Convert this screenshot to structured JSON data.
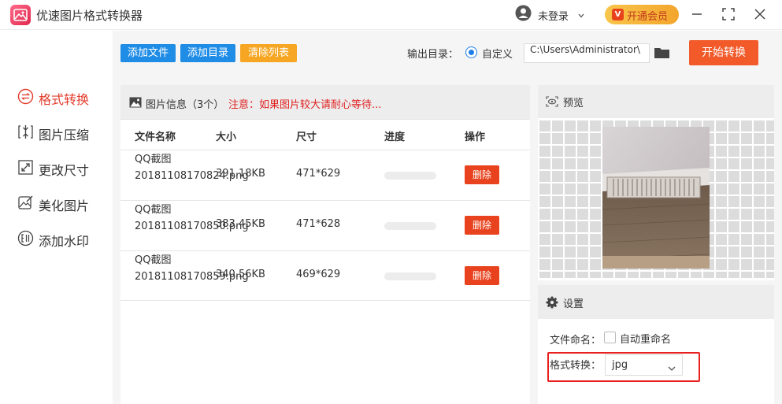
{
  "app": {
    "title": "优速图片格式转换器"
  },
  "header": {
    "login_text": "未登录",
    "vip_badge": "V",
    "vip_label": "开通会员"
  },
  "sidebar": {
    "items": [
      {
        "label": "格式转换",
        "icon": "swap-circle-icon",
        "active": true
      },
      {
        "label": "图片压缩",
        "icon": "compress-icon",
        "active": false
      },
      {
        "label": "更改尺寸",
        "icon": "resize-icon",
        "active": false
      },
      {
        "label": "美化图片",
        "icon": "beautify-image-icon",
        "active": false
      },
      {
        "label": "添加水印",
        "icon": "watermark-icon",
        "active": false
      }
    ]
  },
  "toolbar": {
    "add_file": "添加文件",
    "add_dir": "添加目录",
    "clear_list": "清除列表",
    "output_label": "输出目录：",
    "radio_label": "自定义",
    "output_path": "C:\\Users\\Administrator\\",
    "start_button": "开始转换"
  },
  "file_list": {
    "header_info": "图片信息（3个）",
    "header_notice": "注意：如果图片较大请耐心等待...",
    "columns": [
      "文件名称",
      "大小",
      "尺寸",
      "进度",
      "操作"
    ],
    "rows": [
      {
        "name": "QQ截图20181108170824.png",
        "size": "391.18KB",
        "dimensions": "471*629",
        "progress": 0,
        "action": "删除"
      },
      {
        "name": "QQ截图20181108170850.png",
        "size": "383.45KB",
        "dimensions": "471*628",
        "progress": 0,
        "action": "删除"
      },
      {
        "name": "QQ截图20181108170859.png",
        "size": "340.56KB",
        "dimensions": "469*629",
        "progress": 0,
        "action": "删除"
      }
    ]
  },
  "preview": {
    "title": "预览"
  },
  "settings": {
    "title": "设置",
    "naming_label": "文件命名：",
    "auto_rename_label": "自动重命名",
    "auto_rename_checked": false,
    "format_label": "格式转换：",
    "format_value": "jpg"
  },
  "colors": {
    "accent_red": "#e23b2b",
    "start_button": "#f25a2a",
    "toolbar_blue": "#1f8ce6",
    "toolbar_orange": "#f6a623",
    "highlight_box": "#e8211e"
  }
}
